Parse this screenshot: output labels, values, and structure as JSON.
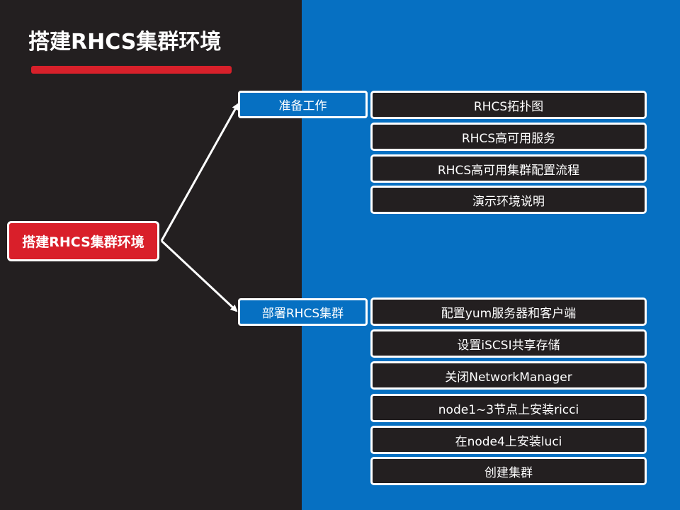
{
  "slide": {
    "title": "搭建RHCS集群环境"
  },
  "mindmap": {
    "root": "搭建RHCS集群环境",
    "branches": [
      {
        "label": "准备工作",
        "items": [
          "RHCS拓扑图",
          "RHCS高可用服务",
          "RHCS高可用集群配置流程",
          "演示环境说明"
        ]
      },
      {
        "label": "部署RHCS集群",
        "items": [
          "配置yum服务器和客户端",
          "设置iSCSI共享存储",
          "关闭NetworkManager",
          "node1~3节点上安装ricci",
          "在node4上安装luci",
          "创建集群"
        ]
      }
    ]
  },
  "colors": {
    "background_dark": "#231f20",
    "background_blue": "#0670c2",
    "accent_red": "#d91f2a",
    "border_white": "#ffffff"
  }
}
